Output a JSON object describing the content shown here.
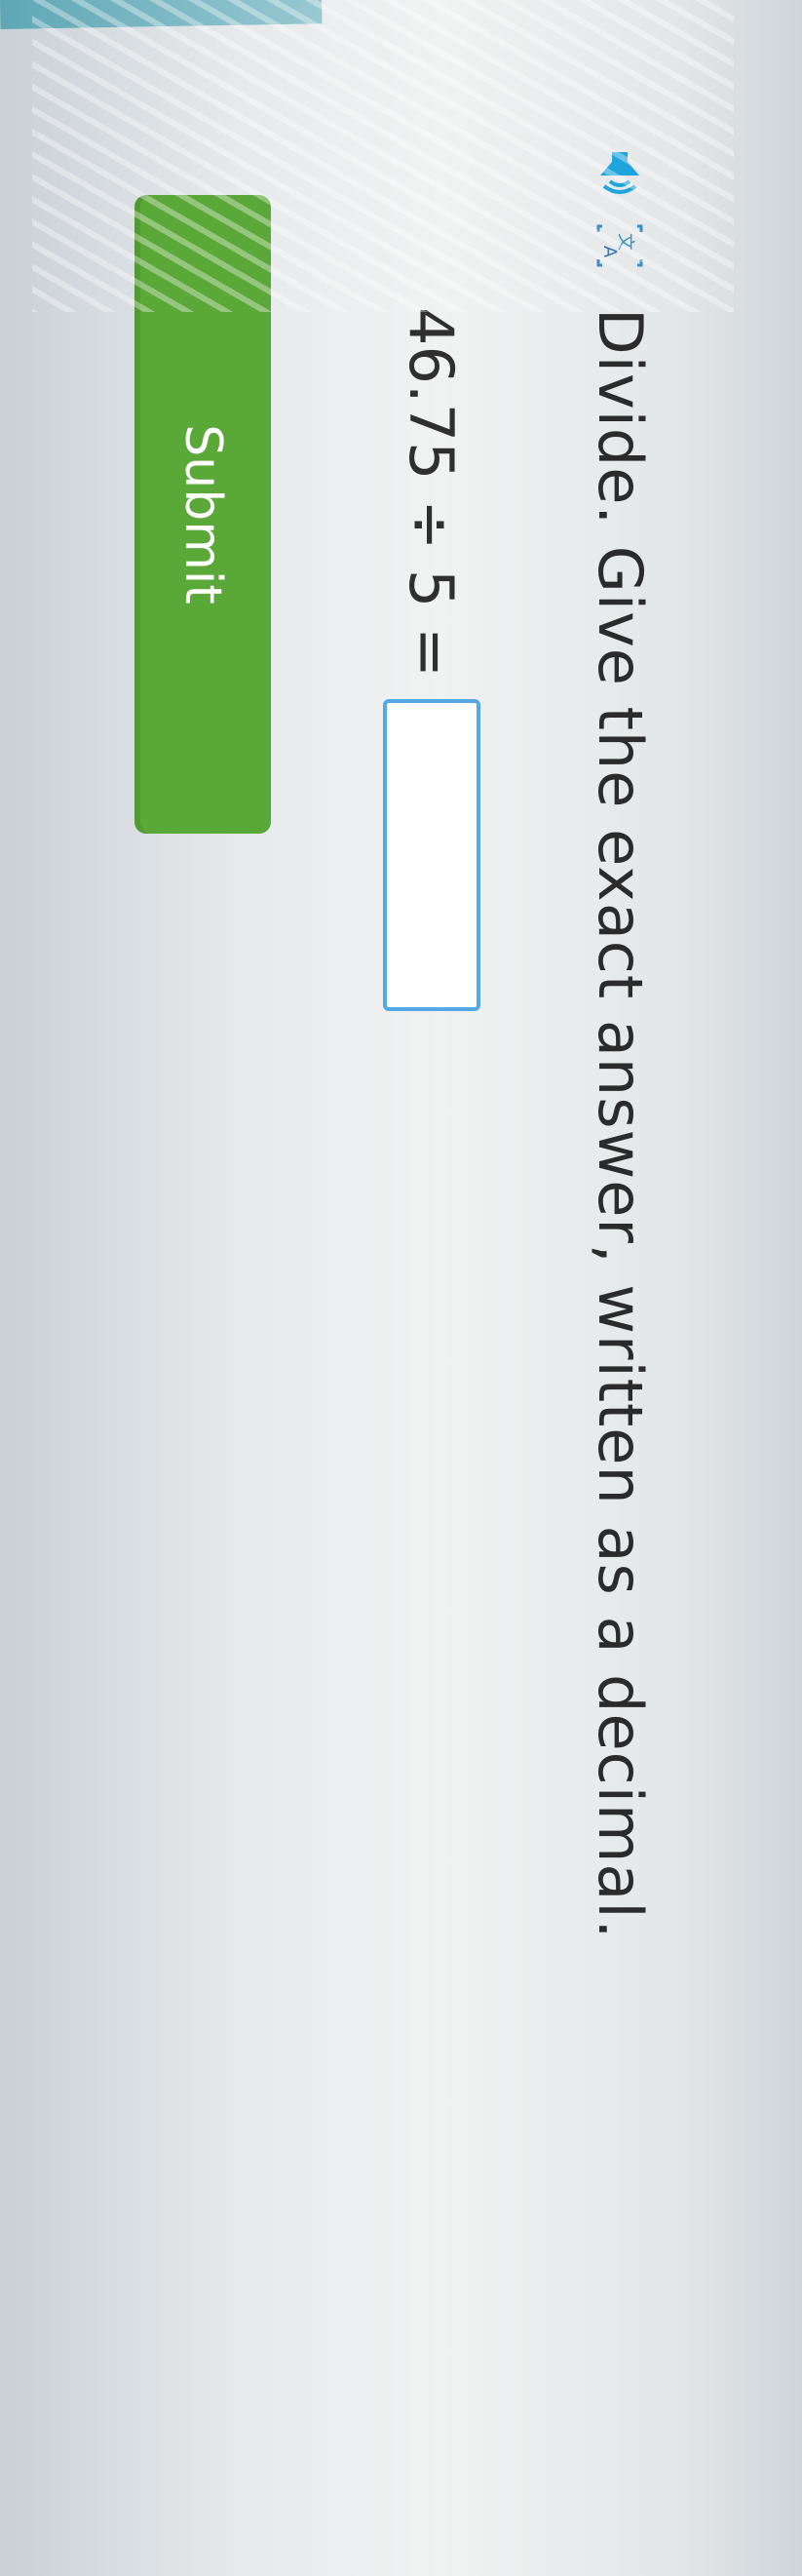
{
  "question": {
    "prompt": "Divide. Give the exact answer, written as a decimal.",
    "speaker_icon": "speaker-icon",
    "language_icon": "language-icon"
  },
  "equation": {
    "left": "46.75 ÷ 5 =",
    "answer_value": ""
  },
  "submit": {
    "label": "Submit"
  },
  "colors": {
    "speaker": "#1ea5dc",
    "answer_border": "#52a9e6",
    "submit_bg": "#5aa838"
  }
}
